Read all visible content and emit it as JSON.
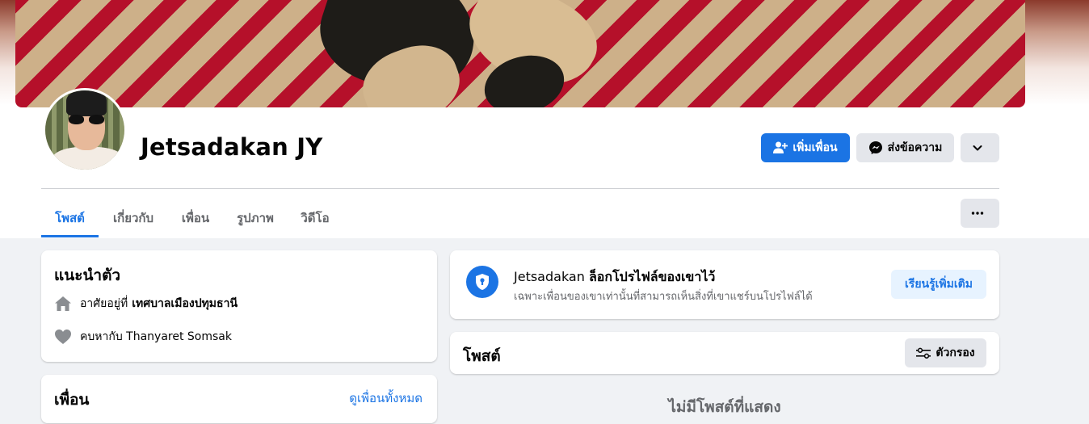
{
  "profile": {
    "name": "Jetsadakan JY"
  },
  "actions": {
    "add_friend": "เพิ่มเพื่อน",
    "message": "ส่งข้อความ"
  },
  "tabs": [
    {
      "label": "โพสต์",
      "active": true
    },
    {
      "label": "เกี่ยวกับ",
      "active": false
    },
    {
      "label": "เพื่อน",
      "active": false
    },
    {
      "label": "รูปภาพ",
      "active": false
    },
    {
      "label": "วิดีโอ",
      "active": false
    }
  ],
  "intro": {
    "title": "แนะนำตัว",
    "lives_prefix": "อาศัยอยู่ที่",
    "lives_place": "เทศบาลเมืองปทุมธานี",
    "relationship": "คบหากับ Thanyaret Somsak"
  },
  "friends": {
    "title": "เพื่อน",
    "see_all": "ดูเพื่อนทั้งหมด"
  },
  "locked": {
    "name": "Jetsadakan",
    "title_suffix": "ล็อกโปรไฟล์ของเขาไว้",
    "subtitle": "เฉพาะเพื่อนของเขาเท่านั้นที่สามารถเห็นสิ่งที่เขาแชร์บนโปรไฟล์ได้",
    "learn_more": "เรียนรู้เพิ่มเติม"
  },
  "posts": {
    "title": "โพสต์",
    "filter": "ตัวกรอง",
    "empty": "ไม่มีโพสต์ที่แสดง"
  },
  "colors": {
    "accent": "#1b74e4",
    "background": "#f0f2f5",
    "secondary_button": "#e4e6eb"
  }
}
